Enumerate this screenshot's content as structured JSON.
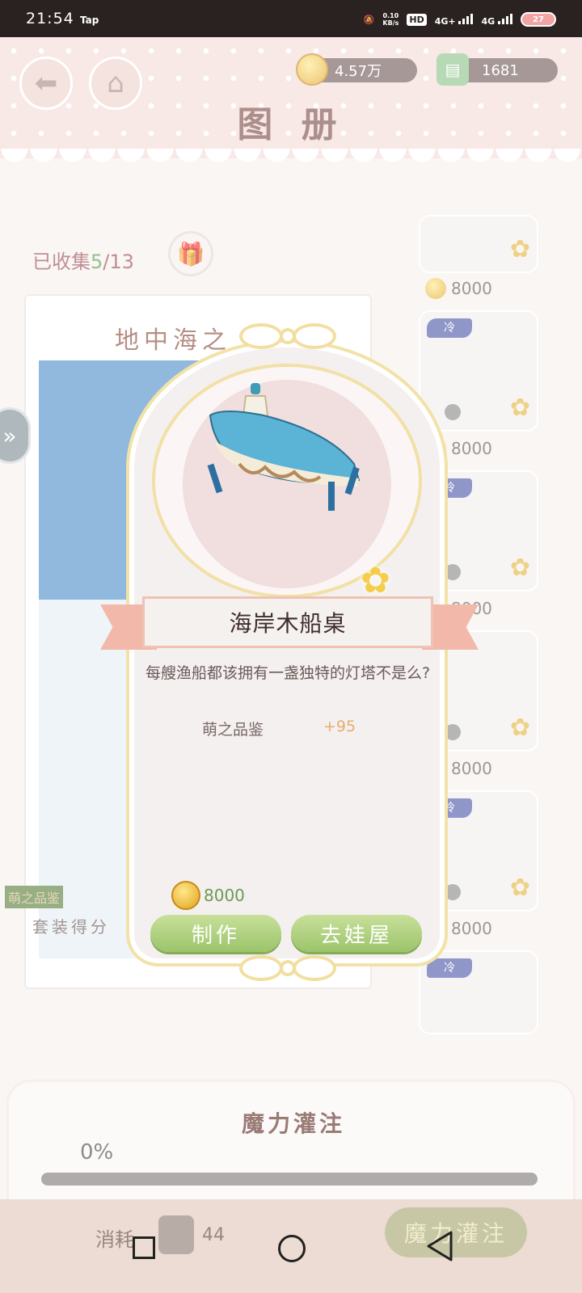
{
  "status_bar": {
    "time": "21:54",
    "app": "Tap",
    "speed_value": "0.10",
    "speed_unit": "KB/s",
    "hd": "HD",
    "sim1": "4G+",
    "sim2": "4G",
    "battery": "27"
  },
  "header": {
    "back_icon": "back-arrow-icon",
    "home_icon": "home-icon",
    "coins": "4.57万",
    "cabinets": "1681",
    "title": "图 册"
  },
  "collection": {
    "label": "已收集",
    "collected": "5",
    "total": "/13",
    "album_title": "地中海之",
    "score_label": "萌之品鉴",
    "score_sub": "套装得分"
  },
  "grid": {
    "prices": [
      "8000",
      "8000",
      "8000",
      "8000",
      "8000"
    ],
    "tag": "冷"
  },
  "popup": {
    "item_name": "海岸木船桌",
    "description": "每艘渔船都该拥有一盏独特的灯塔不是么?",
    "attr_name": "萌之品鉴",
    "attr_value": "+95",
    "cost": "8000",
    "make_button": "制作",
    "go_house_button": "去娃屋"
  },
  "infuse": {
    "title": "魔力灌注",
    "percent": "0%",
    "progress": 0,
    "consume_label": "消耗",
    "consume_value": "44",
    "button": "魔力灌注"
  }
}
